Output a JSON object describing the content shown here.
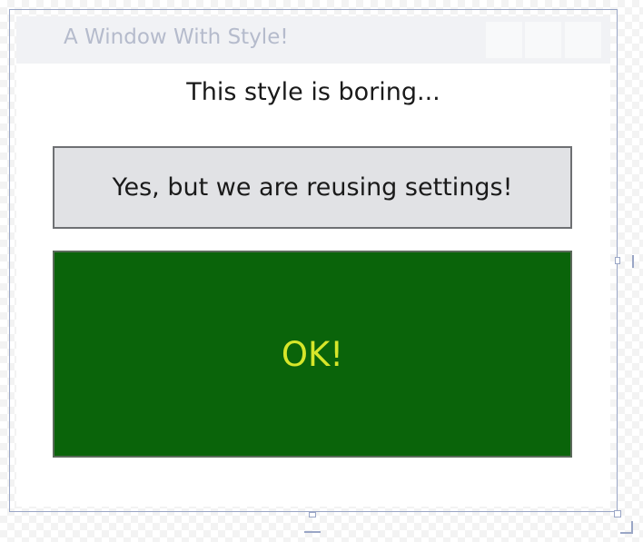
{
  "window": {
    "title": "A Window With Style!"
  },
  "content": {
    "label": "This style is boring...",
    "reuse_button_label": "Yes, but we are reusing settings!",
    "ok_button_label": "OK!"
  },
  "colors": {
    "ok_button_background": "#0a640a",
    "ok_button_text": "#d6e62a",
    "reuse_button_background": "#e1e2e5",
    "title_text": "#b5bbcc"
  }
}
